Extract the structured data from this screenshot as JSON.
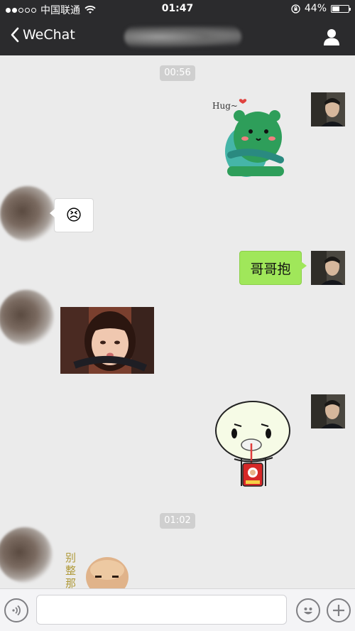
{
  "status_bar": {
    "carrier": "中国联通",
    "time": "01:47",
    "battery_percent": "44%",
    "battery_level": 0.44,
    "signal_dots_filled": 2,
    "signal_dots_total": 5
  },
  "nav": {
    "back_label": "WeChat",
    "title": ""
  },
  "chat": {
    "timestamps": [
      "00:56",
      "01:02"
    ],
    "messages": [
      {
        "sender": "me",
        "type": "sticker",
        "sticker": "green-bear-hug",
        "caption": "Hug~"
      },
      {
        "sender": "friend",
        "type": "emoji",
        "emoji": "😣"
      },
      {
        "sender": "me",
        "type": "text",
        "text": "哥哥抱"
      },
      {
        "sender": "friend",
        "type": "image",
        "image": "girl-pout-photo"
      },
      {
        "sender": "me",
        "type": "sticker",
        "sticker": "round-face-drinking"
      },
      {
        "sender": "friend",
        "type": "sticker",
        "sticker": "bald-man-meme",
        "caption": "别整那"
      }
    ]
  },
  "input_bar": {
    "placeholder": "",
    "value": ""
  },
  "colors": {
    "header_bg": "#2b2b2d",
    "chat_bg": "#ebebeb",
    "my_bubble": "#a0e75a",
    "friend_bubble": "#ffffff",
    "timestamp_bg": "#cfcfcf"
  }
}
